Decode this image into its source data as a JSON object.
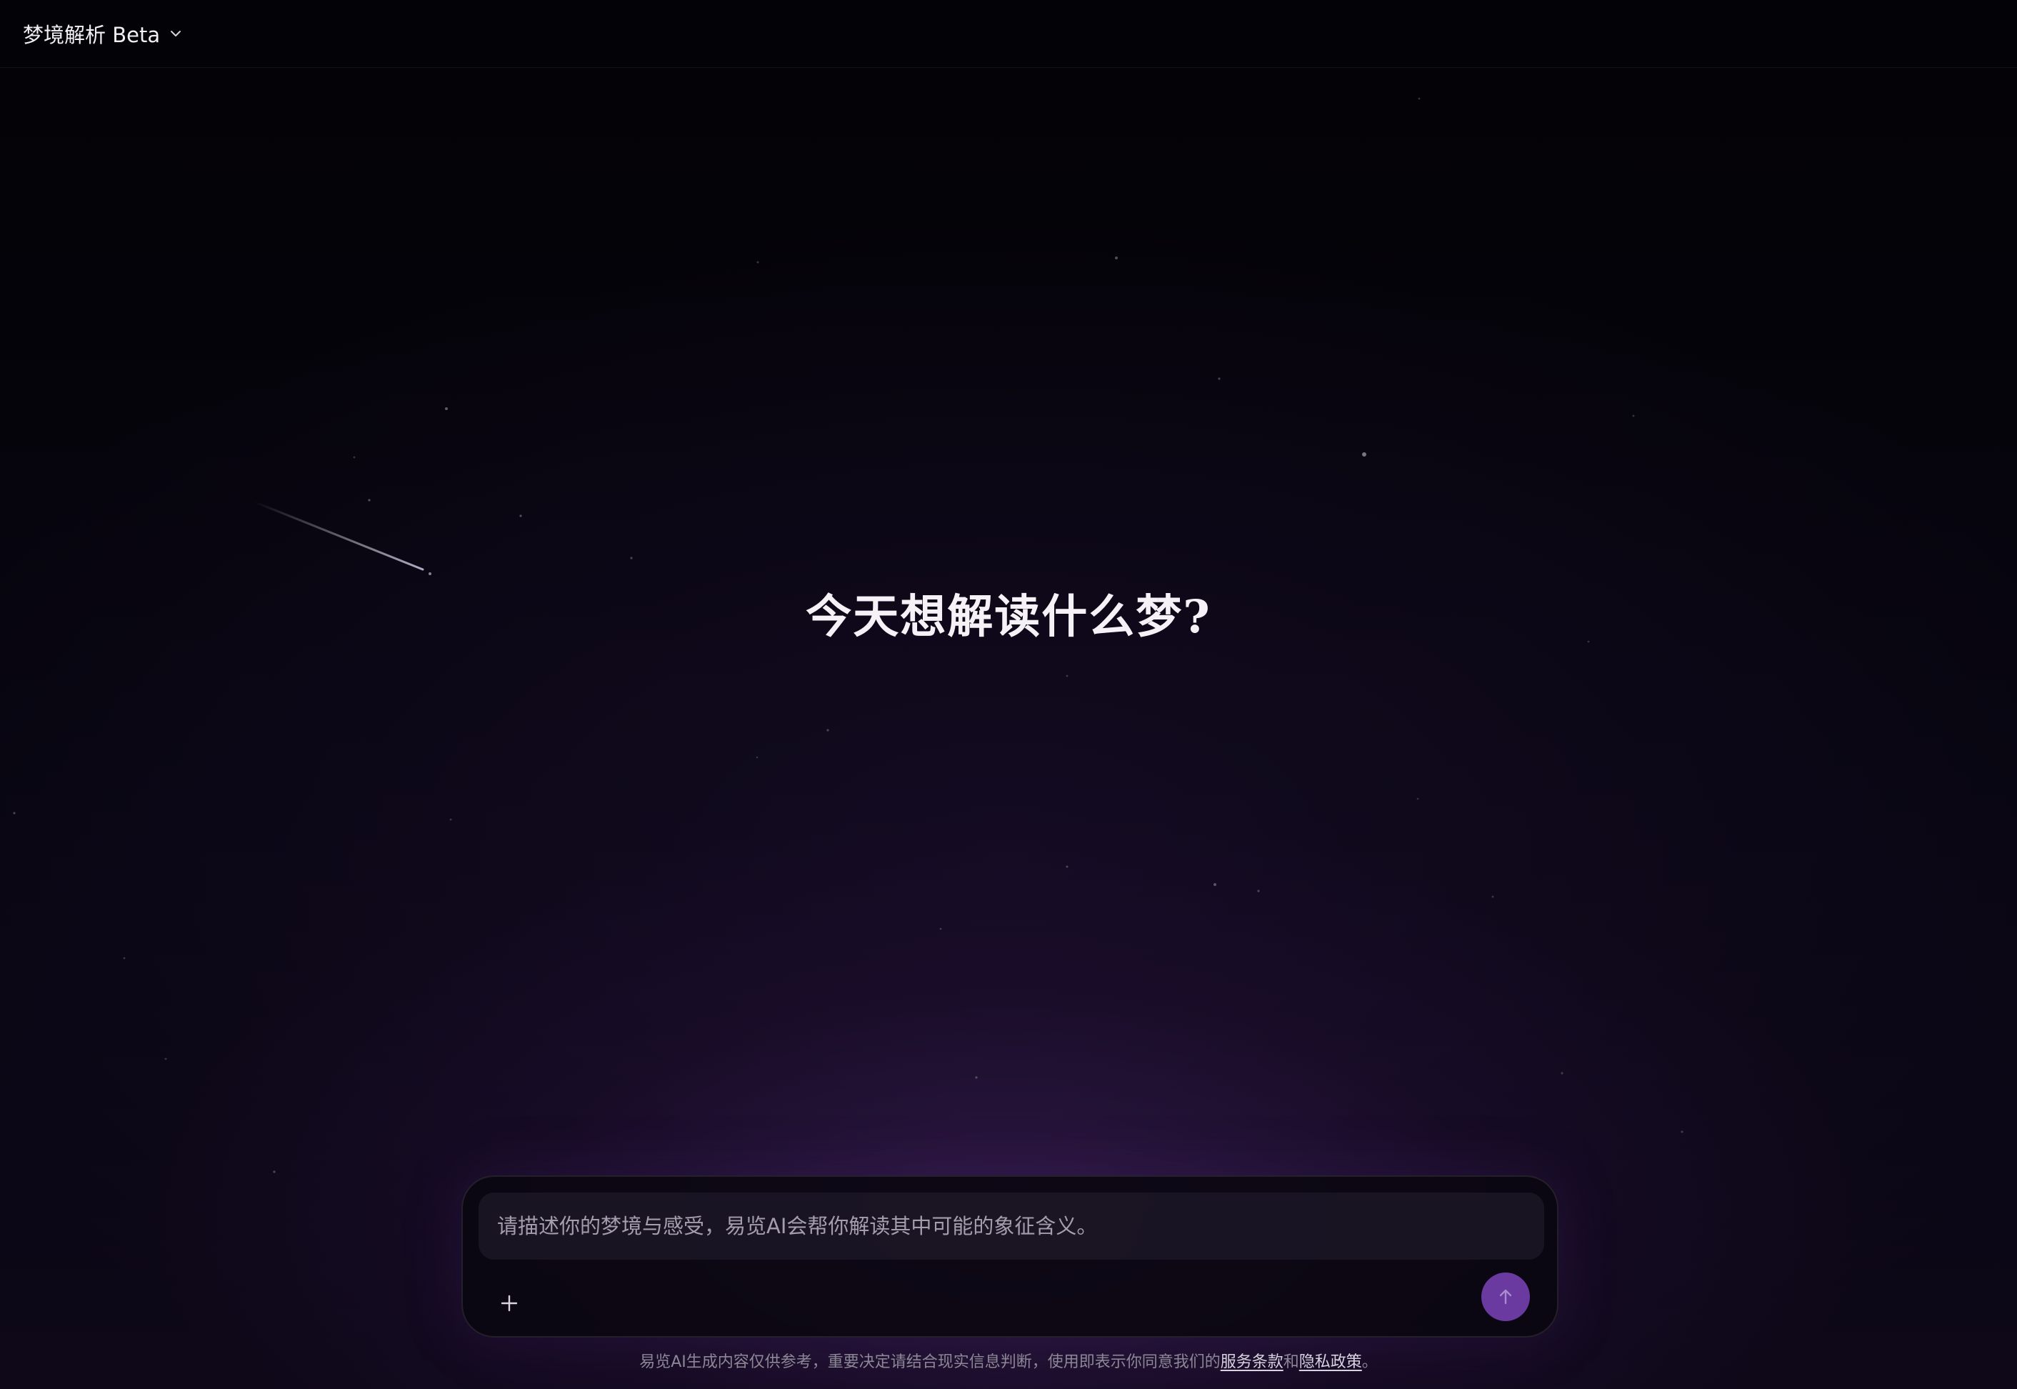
{
  "header": {
    "app_title": "梦境解析 Beta",
    "menu_icon": "chevron-down-icon"
  },
  "hero": {
    "title": "今天想解读什么梦?"
  },
  "composer": {
    "placeholder": "请描述你的梦境与感受，易览AI会帮你解读其中可能的象征含义。",
    "value": "",
    "attach_icon": "plus-icon",
    "send_icon": "arrow-up-icon"
  },
  "footer": {
    "disclaimer": "易览AI生成内容仅供参考，重要决定请结合现实信息判断，使用即表示你同意我们的",
    "terms_link": "服务条款",
    "conjunction": "和",
    "privacy_link": "隐私政策",
    "end_punct": "。"
  },
  "colors": {
    "background": "#050308",
    "send_button": "#6a3aa0",
    "glow": "#46236a"
  }
}
